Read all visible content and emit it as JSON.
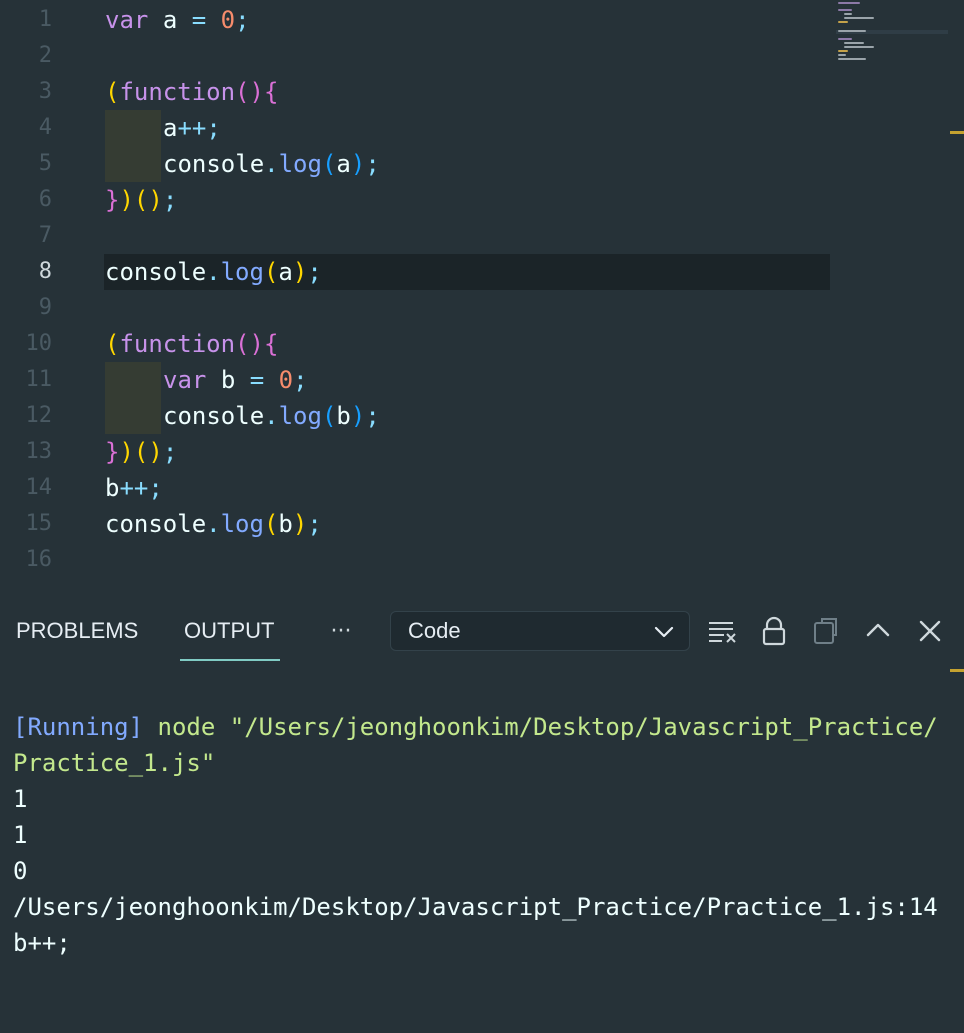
{
  "editor": {
    "active_line": 8,
    "lines": [
      {
        "n": "1"
      },
      {
        "n": "2"
      },
      {
        "n": "3"
      },
      {
        "n": "4"
      },
      {
        "n": "5"
      },
      {
        "n": "6"
      },
      {
        "n": "7"
      },
      {
        "n": "8"
      },
      {
        "n": "9"
      },
      {
        "n": "10"
      },
      {
        "n": "11"
      },
      {
        "n": "12"
      },
      {
        "n": "13"
      },
      {
        "n": "14"
      },
      {
        "n": "15"
      },
      {
        "n": "16"
      }
    ],
    "tokens": {
      "var": "var",
      "a": "a",
      "b": "b",
      "eq": "=",
      "zero": "0",
      "semi": ";",
      "function": "function",
      "lparen": "(",
      "rparen": ")",
      "lbrace": "{",
      "rbrace": "}",
      "incr": "++",
      "console": "console",
      "dot": ".",
      "log": "log"
    }
  },
  "panel": {
    "tabs": {
      "problems": "PROBLEMS",
      "output": "OUTPUT",
      "more": "···"
    },
    "selected_channel": "Code",
    "output_lines": {
      "running_tag": "[Running]",
      "cmd_line1": " node \"/Users/jeonghoonkim/Desktop/Javascript_Practice/",
      "cmd_line2": "Practice_1.js\"",
      "out1": "1",
      "out2": "1",
      "out3": "0",
      "err_path": "/Users/jeonghoonkim/Desktop/Javascript_Practice/Practice_1.js:14",
      "err_code": "b++;"
    }
  },
  "colors": {
    "background": "#263238",
    "keyword": "#c792ea",
    "number": "#f78c6c",
    "function": "#82aaff",
    "operator": "#89ddff",
    "bracket_level1": "#ffd700",
    "bracket_level2": "#da70d6",
    "bracket_level3": "#179fff",
    "output_cmd": "#c3e88d",
    "tab_underline": "#80cbc4"
  }
}
